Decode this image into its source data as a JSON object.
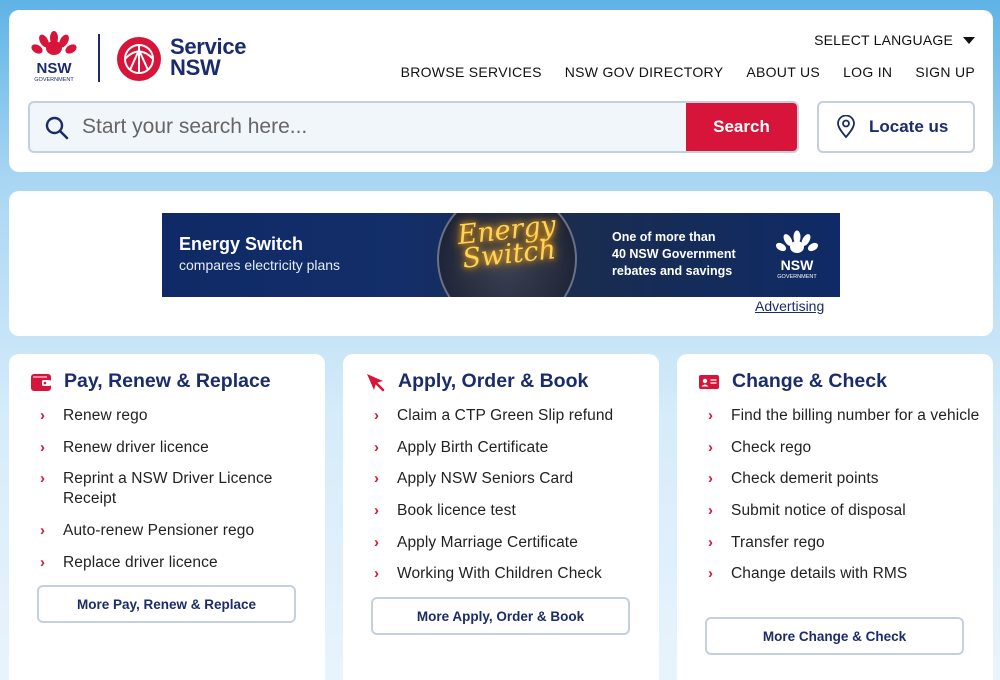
{
  "header": {
    "logo_nsw_text": "NSW",
    "logo_nsw_subtext": "GOVERNMENT",
    "logo_service_line1": "Service",
    "logo_service_line2": "NSW",
    "language_label": "SELECT LANGUAGE",
    "nav": [
      "BROWSE SERVICES",
      "NSW GOV DIRECTORY",
      "ABOUT US",
      "LOG IN",
      "SIGN UP"
    ],
    "search": {
      "placeholder": "Start your search here...",
      "button_label": "Search"
    },
    "locate_label": "Locate us"
  },
  "banner": {
    "title": "Energy Switch",
    "subtitle": "compares electricity plans",
    "glow_line1": "Energy",
    "glow_line2": "Switch",
    "right_line1": "One of more than",
    "right_line2": "40 NSW Government",
    "right_line3": "rebates and savings",
    "logo_text": "NSW",
    "logo_subtext": "GOVERNMENT",
    "advertising_label": "Advertising"
  },
  "cards": [
    {
      "title": "Pay, Renew & Replace",
      "icon": "wallet-icon",
      "items": [
        "Renew rego",
        "Renew driver licence",
        "Reprint a NSW Driver Licence Receipt",
        "Auto-renew Pensioner rego",
        "Replace driver licence"
      ],
      "more_label": "More Pay, Renew & Replace"
    },
    {
      "title": "Apply, Order & Book",
      "icon": "cursor-icon",
      "items": [
        "Claim a CTP Green Slip refund",
        "Apply Birth Certificate",
        "Apply NSW Seniors Card",
        "Book licence test",
        "Apply Marriage Certificate",
        "Working With Children Check"
      ],
      "more_label": "More Apply, Order & Book"
    },
    {
      "title": "Change & Check",
      "icon": "id-card-icon",
      "items": [
        "Find the billing number for a vehicle",
        "Check rego",
        "Check demerit points",
        "Submit notice of disposal",
        "Transfer rego",
        "Change details with RMS"
      ],
      "more_label": "More Change & Check"
    }
  ],
  "colors": {
    "brand_navy": "#1b2c6b",
    "brand_red": "#d7153a"
  }
}
